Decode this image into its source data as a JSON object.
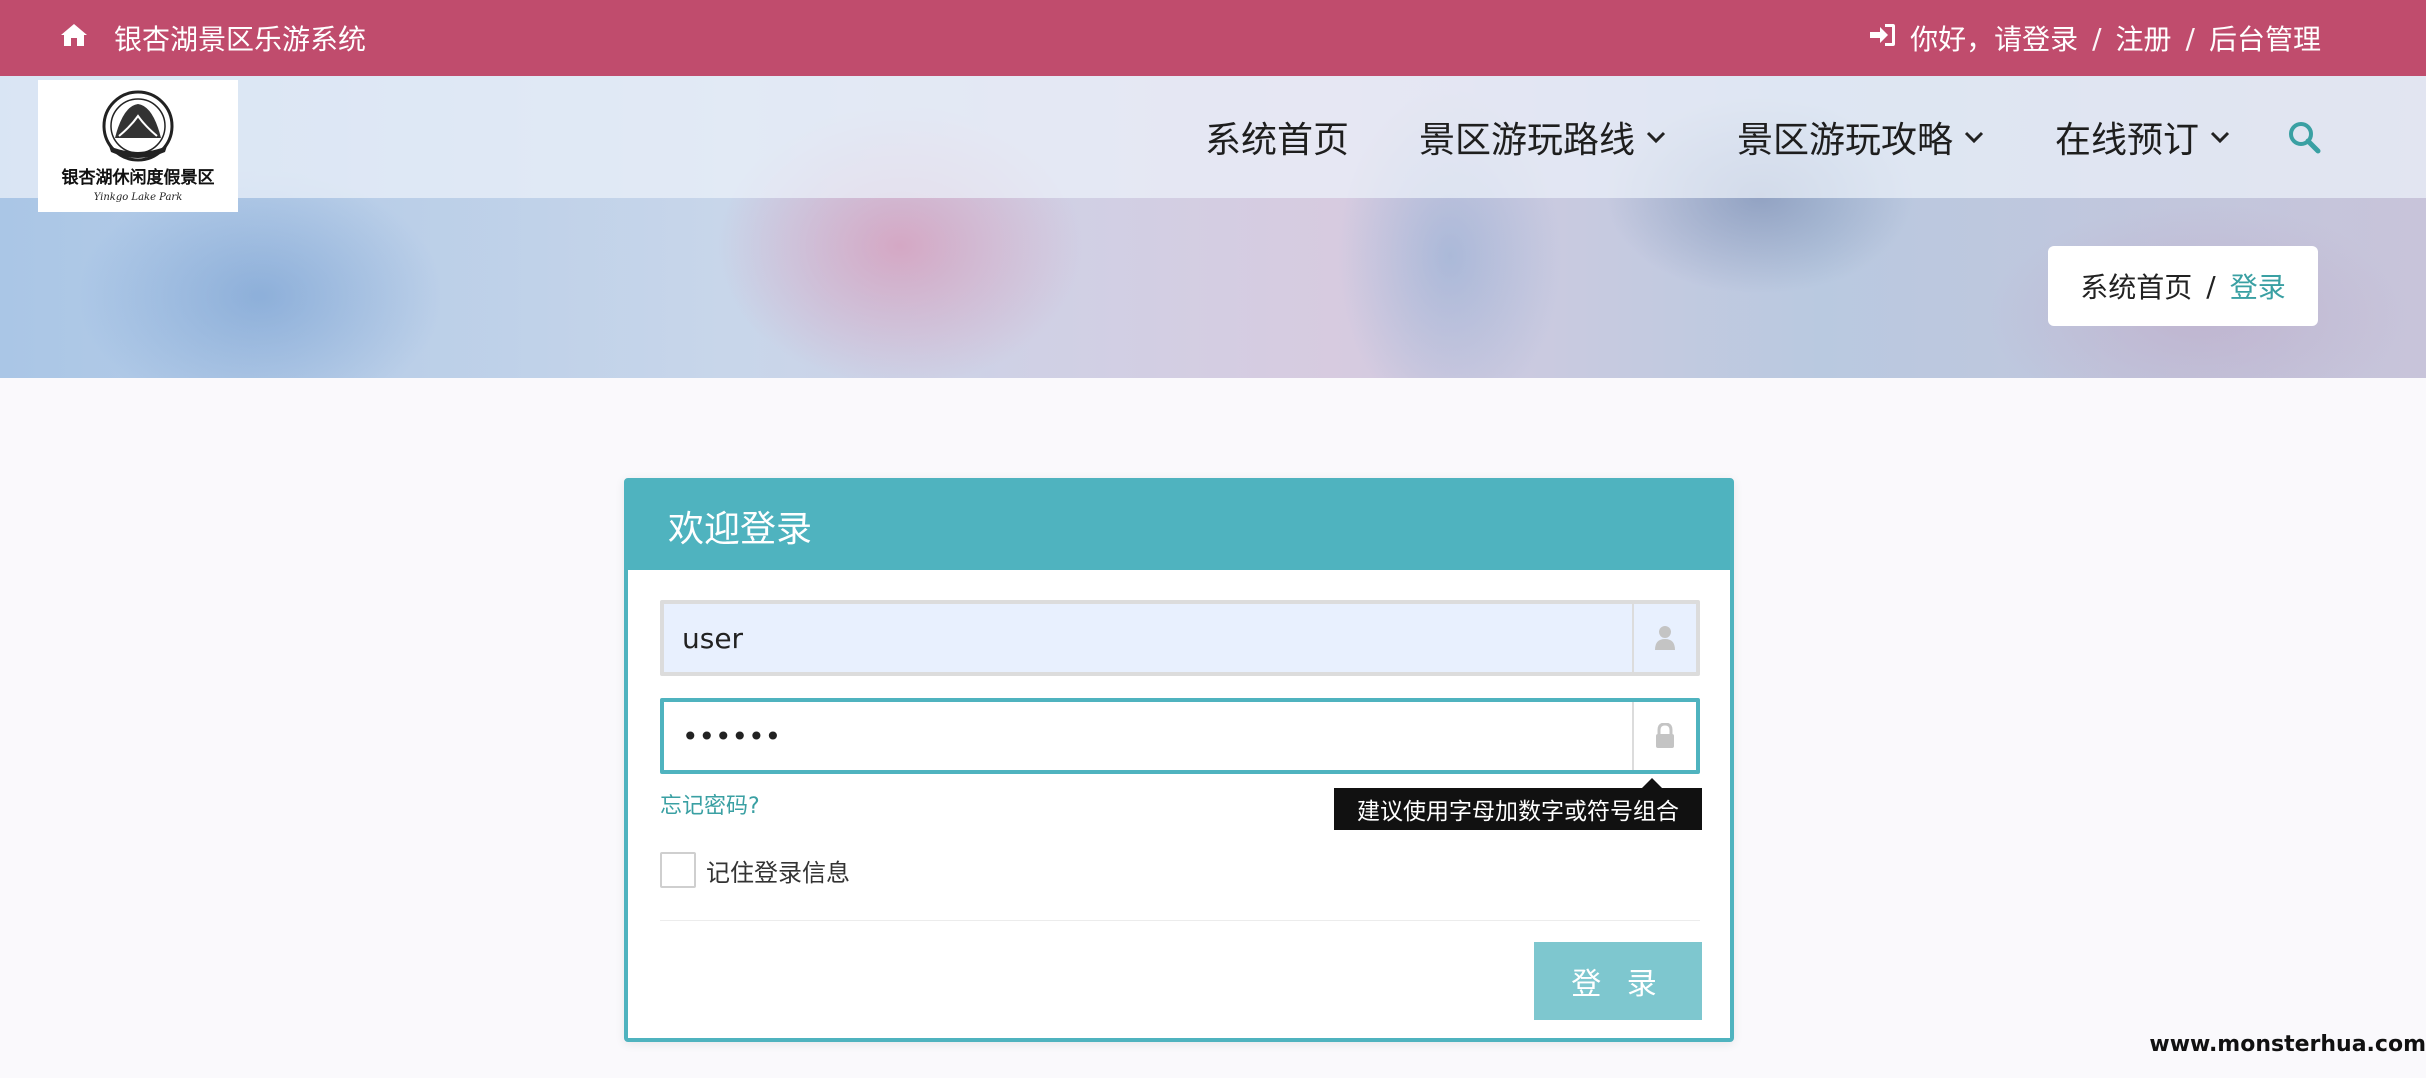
{
  "topbar": {
    "site_title": "银杏湖景区乐游系统",
    "login_prompt": "你好，请登录",
    "separator": "/",
    "register": "注册",
    "admin": "后台管理"
  },
  "logo": {
    "text": "银杏湖休闲度假景区",
    "subtext": "Yinkgo Lake Park"
  },
  "nav": {
    "items": [
      {
        "label": "系统首页",
        "has_dropdown": false
      },
      {
        "label": "景区游玩路线",
        "has_dropdown": true
      },
      {
        "label": "景区游玩攻略",
        "has_dropdown": true
      },
      {
        "label": "在线预订",
        "has_dropdown": true
      }
    ]
  },
  "breadcrumb": {
    "home": "系统首页",
    "separator": "/",
    "current": "登录"
  },
  "login": {
    "heading": "欢迎登录",
    "username_value": "user",
    "password_value": "••••••",
    "forgot": "忘记密码?",
    "tooltip": "建议使用字母加数字或符号组合",
    "remember": "记住登录信息",
    "submit": "登 录"
  },
  "watermark": "www.monsterhua.com",
  "colors": {
    "topbar": "#c04c6d",
    "accent": "#4fb3bf",
    "link": "#3aa0a3",
    "button": "#7ec7cf"
  },
  "icons": [
    "home-icon",
    "sign-in-icon",
    "chevron-down-icon",
    "search-icon",
    "user-icon",
    "lock-icon"
  ]
}
